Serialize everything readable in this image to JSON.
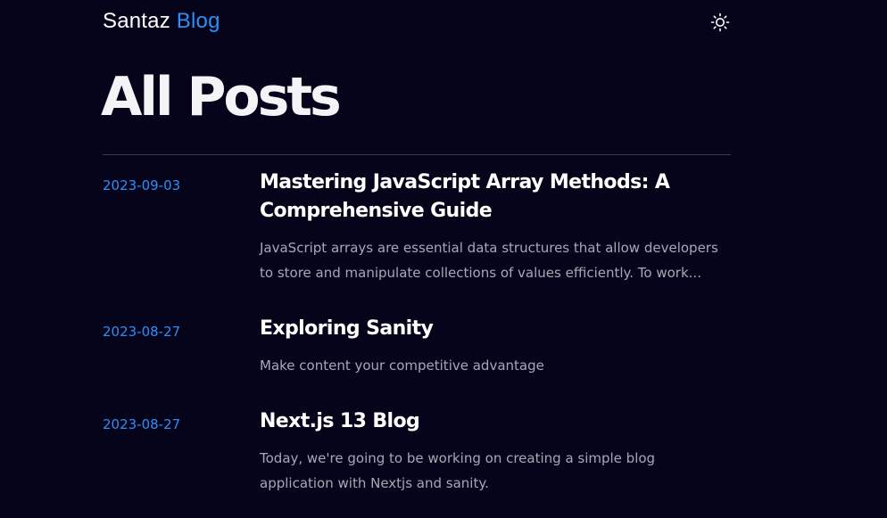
{
  "header": {
    "brand_name": "Santaz",
    "brand_accent": "Blog",
    "theme_toggle_icon": "sun-icon",
    "accent_color": "#2f8ef3",
    "background_color": "#05041a"
  },
  "main": {
    "title": "All Posts",
    "posts": [
      {
        "date": "2023-09-03",
        "title": "Mastering JavaScript Array Methods: A Comprehensive Guide",
        "excerpt": "JavaScript arrays are essential data structures that allow developers to store and manipulate collections of values efficiently. To work..."
      },
      {
        "date": "2023-08-27",
        "title": "Exploring Sanity",
        "excerpt": "Make content your competitive advantage"
      },
      {
        "date": "2023-08-27",
        "title": "Next.js 13 Blog",
        "excerpt": "Today, we're going to be working on creating a simple blog application with Nextjs and sanity."
      }
    ]
  }
}
